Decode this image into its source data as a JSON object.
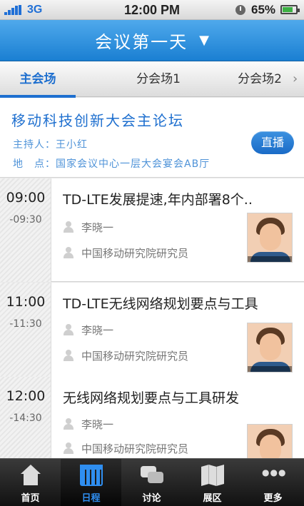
{
  "status_bar": {
    "carrier": "3G",
    "time": "12:00 PM",
    "battery": "65%"
  },
  "title_bar": {
    "title": "会议第一天",
    "dropdown_icon": "caret-down-icon"
  },
  "tabs": [
    {
      "label": "主会场",
      "active": true
    },
    {
      "label": "分会场1",
      "active": false
    },
    {
      "label": "分会场2",
      "active": false
    }
  ],
  "forum": {
    "title": "移动科技创新大会主论坛",
    "host": "主持人：王小红",
    "place": "地　点：国家会议中心一层大会宴会AB厅",
    "live_label": "直播"
  },
  "sessions": [
    {
      "start": "09:00",
      "end": "-09:30",
      "title": "TD-LTE发展提速,年内部署8个..",
      "speaker": "李晓一",
      "org": "中国移动研究院研究员"
    },
    {
      "start": "11:00",
      "end": "-11:30",
      "title": "TD-LTE无线网络规划要点与工具",
      "speaker": "李晓一",
      "org": "中国移动研究院研究员"
    },
    {
      "start": "12:00",
      "end": "-14:30",
      "title": "无线网络规划要点与工具研发",
      "speaker": "李晓一",
      "org": "中国移动研究院研究员"
    }
  ],
  "tab_bar": [
    {
      "label": "首页",
      "icon": "home-icon",
      "active": false
    },
    {
      "label": "日程",
      "icon": "calendar-icon",
      "active": true
    },
    {
      "label": "讨论",
      "icon": "chat-icon",
      "active": false
    },
    {
      "label": "展区",
      "icon": "map-icon",
      "active": false
    },
    {
      "label": "更多",
      "icon": "more-icon",
      "active": false
    }
  ],
  "colors": {
    "accent": "#1e6fcf",
    "title_bar": "#1a7fd2",
    "tab_bar": "#111111"
  }
}
